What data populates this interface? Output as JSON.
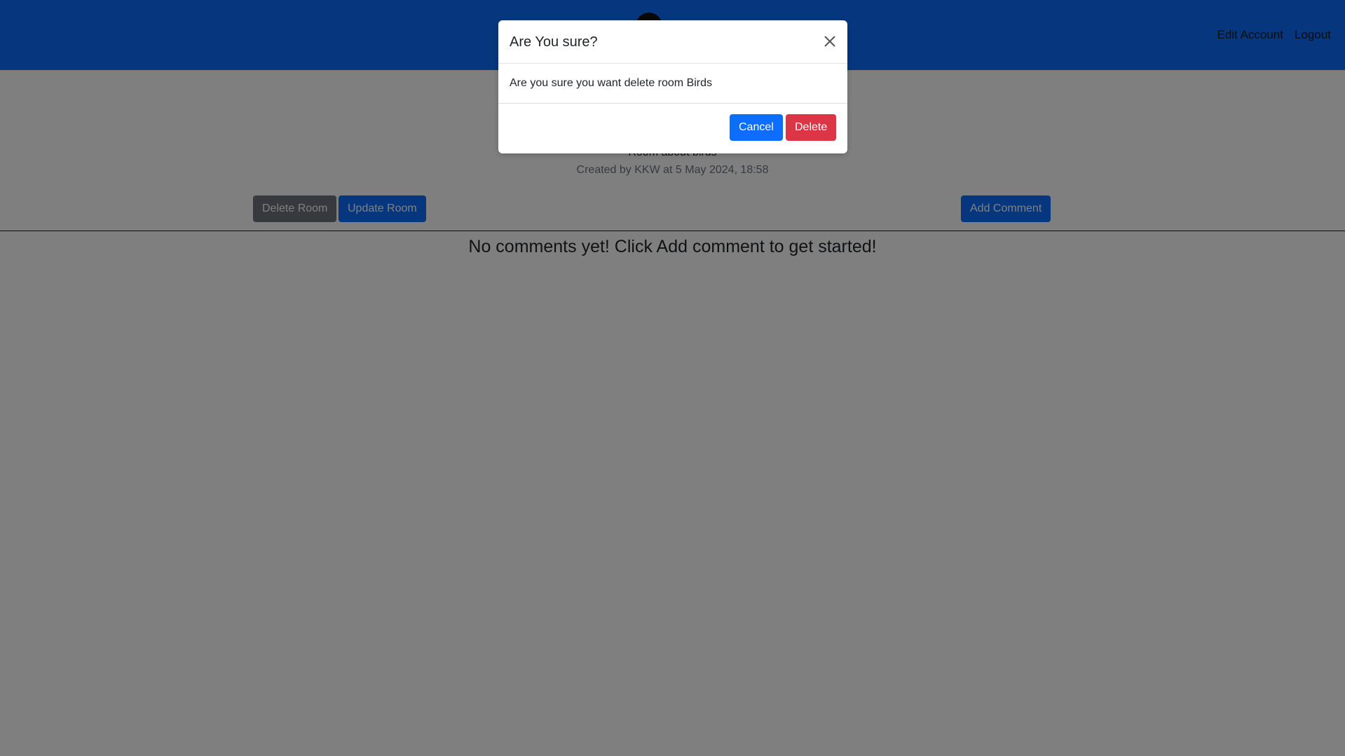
{
  "navbar": {
    "edit_account": "Edit Account",
    "logout": "Logout"
  },
  "room": {
    "title": "",
    "description": "Room about birds",
    "meta": "Created by KKW at 5 May 2024, 18:58"
  },
  "actions": {
    "delete_room": "Delete Room",
    "update_room": "Update Room",
    "add_comment": "Add Comment"
  },
  "comments": {
    "empty_message": "No comments yet! Click Add comment to get started!"
  },
  "modal": {
    "title": "Are You sure?",
    "body": "Are you sure you want delete room Birds",
    "cancel_label": "Cancel",
    "delete_label": "Delete"
  },
  "colors": {
    "navbar": "#0d6efd",
    "primary": "#0d6efd",
    "secondary": "#6c757d",
    "danger": "#dc3545",
    "backdrop": "rgba(0,0,0,0.5)"
  },
  "icons": {
    "close": "close-icon",
    "logo": "logo-icon"
  }
}
